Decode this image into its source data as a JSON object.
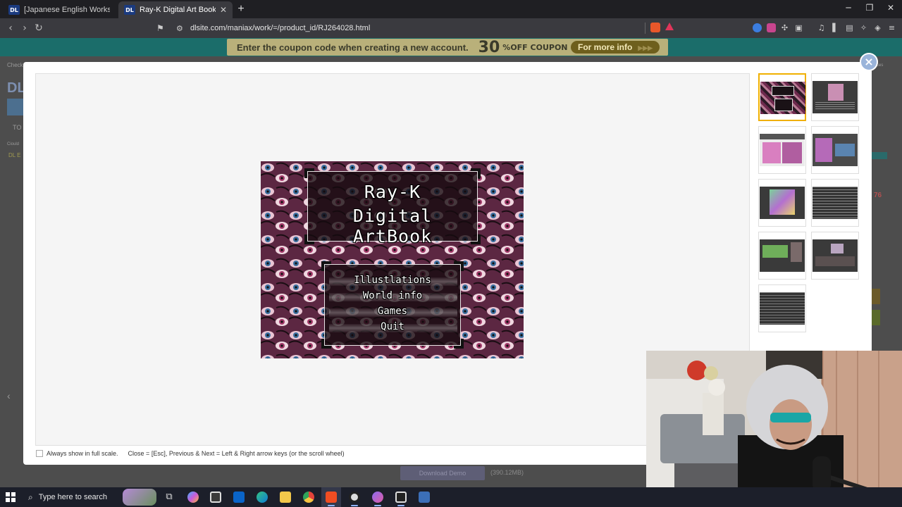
{
  "browser": {
    "tabs": [
      {
        "favicon": "DL",
        "title": "[Japanese English Works Alingual Ray",
        "active": false
      },
      {
        "favicon": "DL",
        "title": "Ray-K Digital Art Book [FreakilyC",
        "active": true
      }
    ],
    "url": "dlsite.com/maniax/work/=/product_id/RJ264028.html",
    "window_controls": [
      "─",
      "❐",
      "✕"
    ]
  },
  "banner": {
    "text": "Enter the coupon code when creating a new account.",
    "percent": "30",
    "off_label": "%OFF COUPON",
    "button": "For more info"
  },
  "background_page": {
    "fragments": [
      "Check",
      "DL",
      "TO",
      "Ciould",
      "DL E",
      "76",
      "ces"
    ],
    "demo_button": "Download Demo",
    "demo_size": "(390.12MB)"
  },
  "modal": {
    "close_symbol": "×",
    "main_image": {
      "title_line1": "Ray-K",
      "title_line2": "Digital ArtBook",
      "menu": [
        "Illustlations",
        "World info",
        "Games",
        "Quit"
      ]
    },
    "thumbnail_count": 9,
    "selected_thumbnail": 1,
    "footer": {
      "checkbox_label": "Always show in full scale.",
      "hint": "Close = [Esc], Previous & Next = Left & Right arrow keys (or the scroll wheel)"
    }
  },
  "taskbar": {
    "search_placeholder": "Type here to search"
  },
  "colors": {
    "banner_bg": "#1b6d6a",
    "coupon_bg": "#b9b07a",
    "close_button": "#9ab4da",
    "selected_thumb_border": "#f0b000",
    "taskbar": "#1c1f2a"
  }
}
